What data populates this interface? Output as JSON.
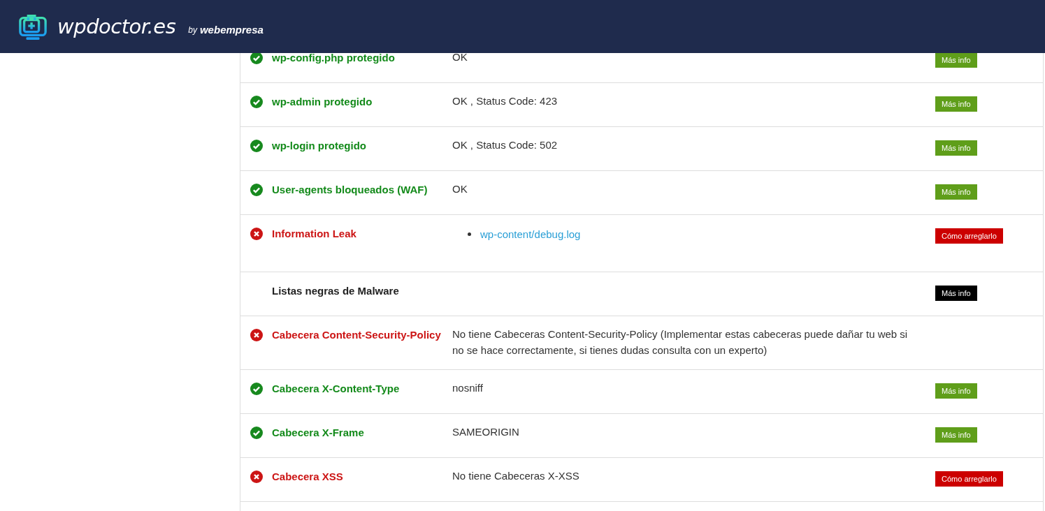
{
  "header": {
    "brand": "wpdoctor.es",
    "by": "by",
    "partner": "webempresa"
  },
  "checks": [
    {
      "name": "wp-config.php protegido",
      "kind": "pass",
      "value": "OK",
      "button": "Más info"
    },
    {
      "name": "wp-admin protegido",
      "kind": "pass",
      "value": "OK , Status Code: 423",
      "button": "Más info"
    },
    {
      "name": "wp-login protegido",
      "kind": "pass",
      "value": "OK , Status Code: 502",
      "button": "Más info"
    },
    {
      "name": "User-agents bloqueados (WAF)",
      "kind": "pass",
      "value": "OK",
      "button": "Más info"
    },
    {
      "name": "Information Leak",
      "kind": "fail",
      "links": [
        "wp-content/debug.log"
      ],
      "button": "Cómo arreglarlo"
    },
    {
      "name": "Listas negras de Malware",
      "kind": "neutral",
      "button": "Más info"
    },
    {
      "name": "Cabecera Content-Security-Policy",
      "kind": "fail",
      "value": "No tiene Cabeceras Content-Security-Policy (Implementar estas cabeceras puede dañar tu web si no se hace correctamente, si tienes dudas consulta con un experto)"
    },
    {
      "name": "Cabecera X-Content-Type",
      "kind": "pass",
      "value": "nosniff",
      "button": "Más info"
    },
    {
      "name": "Cabecera X-Frame",
      "kind": "pass",
      "value": "SAMEORIGIN",
      "button": "Más info"
    },
    {
      "name": "Cabecera XSS",
      "kind": "fail",
      "value": "No tiene Cabeceras X-XSS",
      "button": "Cómo arreglarlo"
    }
  ]
}
